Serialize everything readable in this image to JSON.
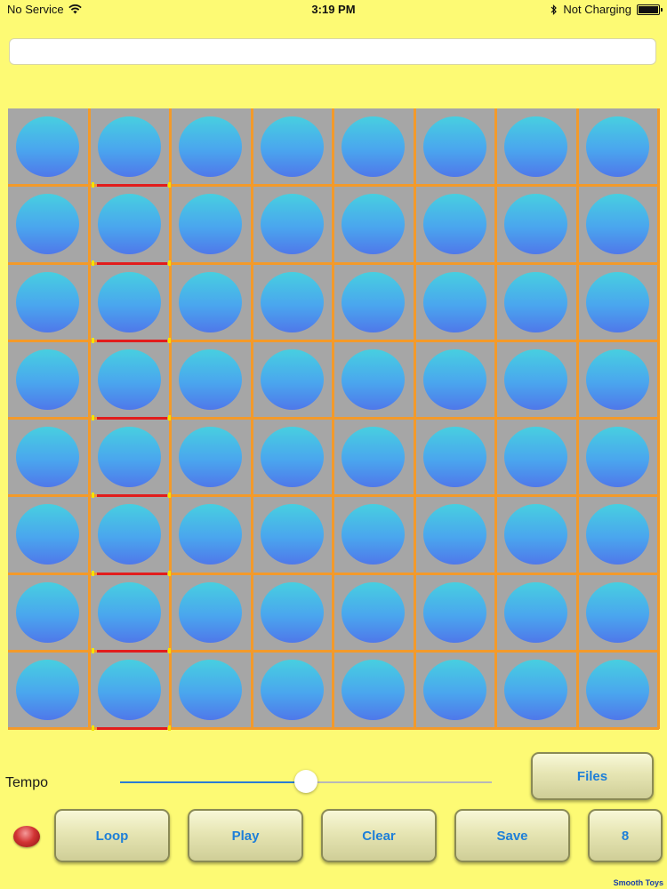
{
  "status_bar": {
    "carrier": "No Service",
    "time": "3:19 PM",
    "battery_text": "Not Charging",
    "wifi_icon": "wifi-icon",
    "bluetooth_icon": "bluetooth-icon"
  },
  "title_field": {
    "value": "",
    "placeholder": ""
  },
  "grid": {
    "rows": 8,
    "columns": 8,
    "selected_column": 2,
    "cell_color": "#4aa6ee",
    "line_color": "#f39a2a",
    "selection_color": "#e21c1c"
  },
  "controls": {
    "tempo_label": "Tempo",
    "tempo_value": 0.5,
    "buttons": {
      "files": "Files",
      "loop": "Loop",
      "play": "Play",
      "clear": "Clear",
      "save": "Save",
      "steps": "8"
    }
  },
  "footer": {
    "brand": "Smooth Toys"
  },
  "colors": {
    "background": "#fdfa74",
    "button_text": "#1e7fd8",
    "indicator": "#d23434"
  }
}
